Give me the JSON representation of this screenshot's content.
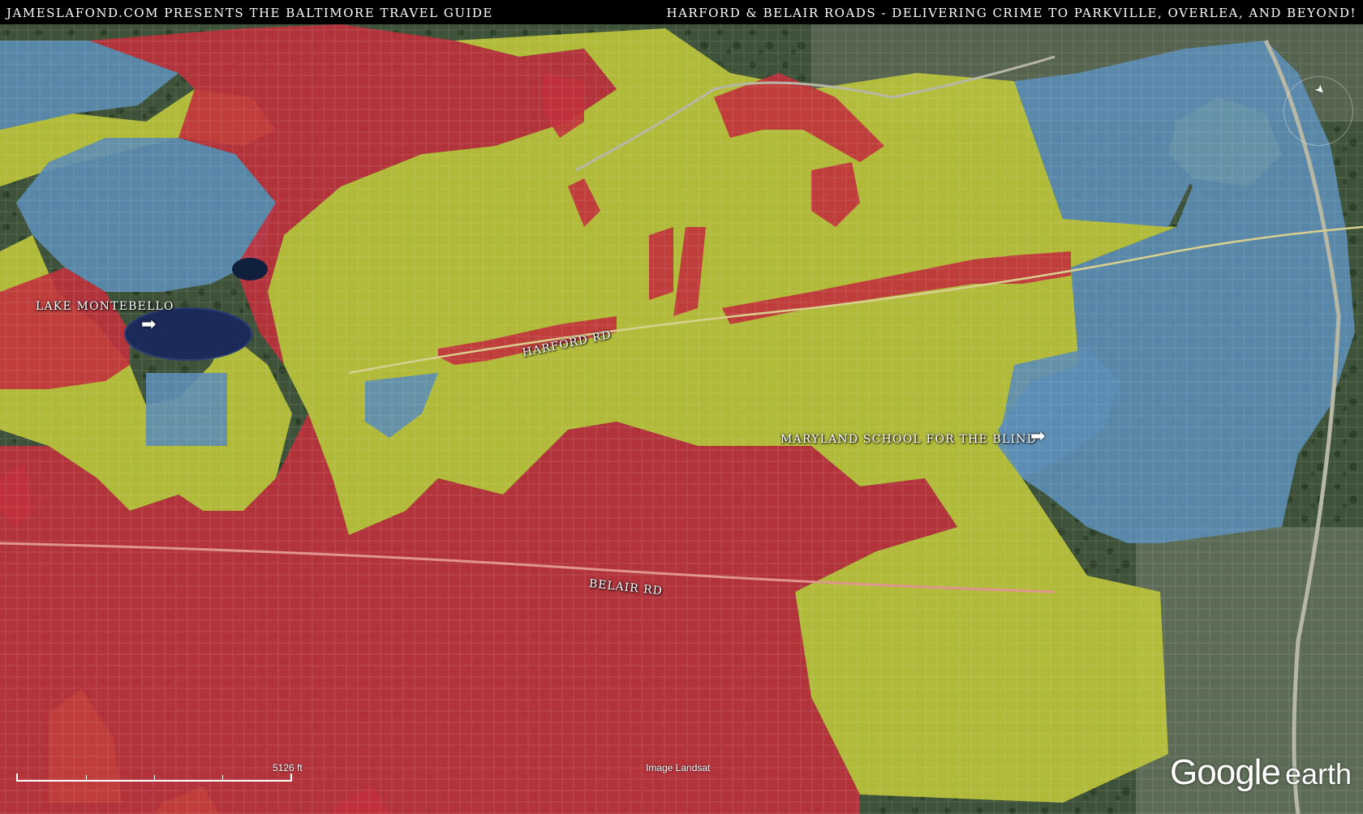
{
  "header": {
    "left_title": "JAMESLAFOND.COM PRESENTS THE BALTIMORE TRAVEL GUIDE",
    "right_title": "HARFORD & BELAIR ROADS - DELIVERING CRIME TO PARKVILLE, OVERLEA, AND BEYOND!"
  },
  "labels": {
    "lake": "LAKE MONTEBELLO",
    "harford_rd": "HARFORD RD",
    "belair_rd": "BELAIR RD",
    "school": "MARYLAND SCHOOL FOR THE BLIND"
  },
  "arrow_glyph": "➡",
  "map_footer": {
    "scale": "5126 ft",
    "image_credit": "Image Landsat",
    "logo_google": "Google",
    "logo_earth": "earth"
  },
  "colors": {
    "red_zone": "#c0303c",
    "yellow_zone": "#bcc43a",
    "blue_zone": "#5b8db5",
    "terrain": "#3d5238",
    "lake": "#1c2a5a"
  },
  "icons": {
    "compass": "compass-icon",
    "arrow": "arrow-right-icon"
  }
}
